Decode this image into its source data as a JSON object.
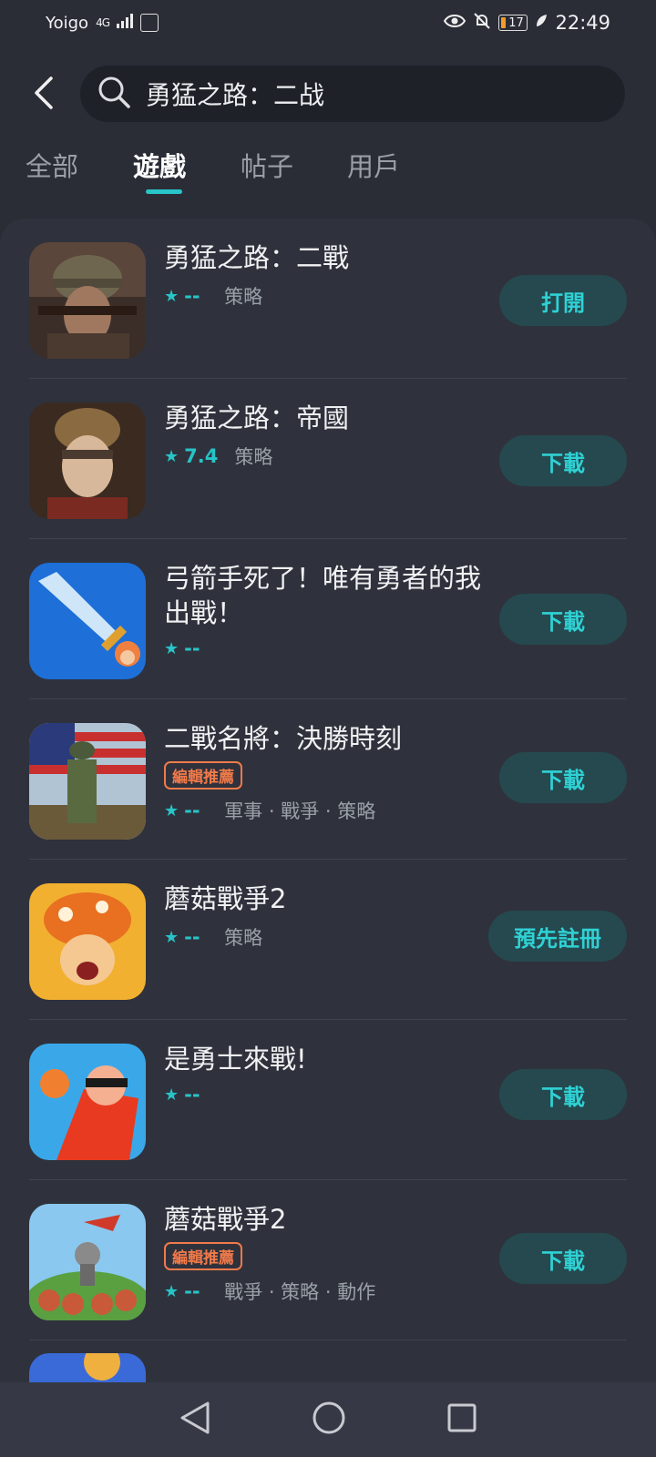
{
  "status": {
    "carrier": "Yoigo",
    "signal": "4G",
    "battery": "17",
    "time": "22:49"
  },
  "search": {
    "query": "勇猛之路：二战"
  },
  "tabs": [
    {
      "label": "全部"
    },
    {
      "label": "遊戲"
    },
    {
      "label": "帖子"
    },
    {
      "label": "用戶"
    }
  ],
  "results": [
    {
      "title": "勇猛之路：二戰",
      "badge": "",
      "rating": "--",
      "genres": "策略",
      "action": "打開"
    },
    {
      "title": "勇猛之路：帝國",
      "badge": "",
      "rating": "7.4",
      "genres": "策略",
      "action": "下載"
    },
    {
      "title": "弓箭手死了！唯有勇者的我出戰！",
      "badge": "",
      "rating": "--",
      "genres": "",
      "action": "下載"
    },
    {
      "title": "二戰名將：決勝時刻",
      "badge": "編輯推薦",
      "rating": "--",
      "genres": "軍事 · 戰爭 · 策略",
      "action": "下載"
    },
    {
      "title": "蘑菇戰爭2",
      "badge": "",
      "rating": "--",
      "genres": "策略",
      "action": "預先註冊"
    },
    {
      "title": "是勇士來戰!",
      "badge": "",
      "rating": "--",
      "genres": "",
      "action": "下載"
    },
    {
      "title": "蘑菇戰爭2",
      "badge": "編輯推薦",
      "rating": "--",
      "genres": "戰爭 · 策略 · 動作",
      "action": "下載"
    }
  ],
  "colors": {
    "accent": "#27c4c8",
    "badge": "#f07a4a",
    "background": "#2a2d36"
  },
  "icons": [
    "back-arrow-icon",
    "search-icon",
    "star-icon",
    "nav-back-icon",
    "nav-home-icon",
    "nav-recents-icon"
  ]
}
